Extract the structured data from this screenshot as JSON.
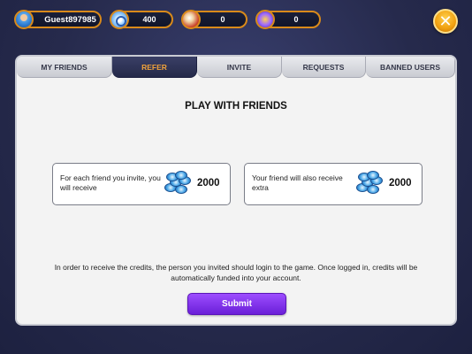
{
  "topbar": {
    "username": "Guest897985",
    "coins": "400",
    "gems": "0",
    "tickets": "0",
    "close_symbol": "✕"
  },
  "tabs": [
    {
      "label": "MY FRIENDS",
      "active": false
    },
    {
      "label": "REFER",
      "active": true
    },
    {
      "label": "INVITE",
      "active": false
    },
    {
      "label": "REQUESTS",
      "active": false
    },
    {
      "label": "BANNED USERS",
      "active": false
    }
  ],
  "panel": {
    "title": "PLAY WITH FRIENDS",
    "cards": [
      {
        "text": "For each friend you invite, you will receive",
        "value": "2000",
        "icon": "chips-icon"
      },
      {
        "text": "Your friend will also receive extra",
        "value": "2000",
        "icon": "chips-icon"
      }
    ],
    "info": "In order to receive the credits, the person you invited should login to the game. Once logged in, credits will be automatically funded into your account.",
    "submit_label": "Submit"
  },
  "colors": {
    "accent_orange": "#f0a23a",
    "submit_purple": "#7b2ff0",
    "active_tab": "#2c3155",
    "background": "#262a4c"
  }
}
